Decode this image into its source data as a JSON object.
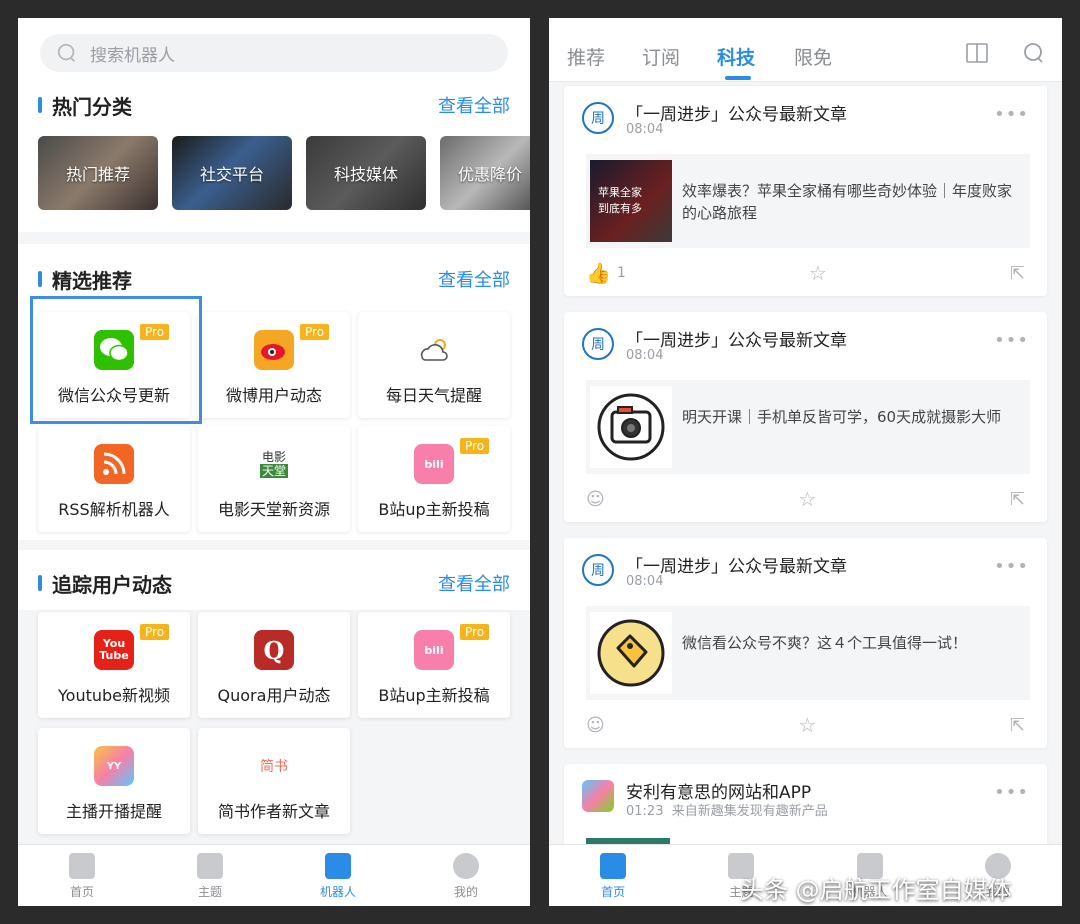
{
  "left": {
    "search": {
      "placeholder": "搜索机器人"
    },
    "hot": {
      "title": "热门分类",
      "see_all": "查看全部",
      "categories": [
        "热门推荐",
        "社交平台",
        "科技媒体",
        "优惠降价"
      ]
    },
    "featured": {
      "title": "精选推荐",
      "see_all": "查看全部",
      "bots": [
        {
          "name": "微信公众号更新",
          "pro": "Pro",
          "icon": "wechat-icon",
          "color": "#2dc100"
        },
        {
          "name": "微博用户动态",
          "pro": "Pro",
          "icon": "weibo-icon",
          "color": "#f5a623"
        },
        {
          "name": "每日天气提醒",
          "pro": "",
          "icon": "weather-icon",
          "color": "#ffffff"
        },
        {
          "name": "RSS解析机器人",
          "pro": "",
          "icon": "rss-icon",
          "color": "#f26522"
        },
        {
          "name": "电影天堂新资源",
          "pro": "",
          "icon": "movie-icon",
          "color": "#ffffff"
        },
        {
          "name": "B站up主新投稿",
          "pro": "Pro",
          "icon": "bilibili-icon",
          "color": "#f77fa9"
        }
      ]
    },
    "track": {
      "title": "追踪用户动态",
      "see_all": "查看全部",
      "bots": [
        {
          "name": "Youtube新视频",
          "pro": "Pro",
          "icon": "youtube-icon",
          "color": "#e62117"
        },
        {
          "name": "Quora用户动态",
          "pro": "",
          "icon": "quora-icon",
          "color": "#b92b27"
        },
        {
          "name": "B站up主新投稿",
          "pro": "Pro",
          "icon": "bilibili-icon",
          "color": "#f77fa9"
        },
        {
          "name": "主播开播提醒",
          "pro": "",
          "icon": "live-icon",
          "color": "#f5c342"
        },
        {
          "name": "简书作者新文章",
          "pro": "",
          "icon": "jianshu-icon",
          "color": "#ffffff"
        }
      ]
    },
    "tabbar": [
      {
        "label": "首页",
        "icon": "home-icon"
      },
      {
        "label": "主题",
        "icon": "grid-icon"
      },
      {
        "label": "机器人",
        "icon": "robot-icon"
      },
      {
        "label": "我的",
        "icon": "user-icon"
      }
    ]
  },
  "right": {
    "tabs": [
      "推荐",
      "订阅",
      "科技",
      "限免"
    ],
    "active_tab": "科技",
    "cards": [
      {
        "avatar": "周",
        "title": "「一周进步」公众号最新文章",
        "time": "08:04",
        "body": "效率爆表？苹果全家桶有哪些奇妙体验｜年度败家的心路旅程",
        "likes": "1"
      },
      {
        "avatar": "周",
        "title": "「一周进步」公众号最新文章",
        "time": "08:04",
        "body": "明天开课｜手机单反皆可学，60天成就摄影大师",
        "likes": ""
      },
      {
        "avatar": "周",
        "title": "「一周进步」公众号最新文章",
        "time": "08:04",
        "body": "微信看公众号不爽？这４个工具值得一试！",
        "likes": ""
      },
      {
        "avatar": "",
        "title": "安利有意思的网站和APP",
        "time": "01:23",
        "subtitle": "来自新趣集发现有趣新产品"
      }
    ],
    "thumb1_text": "苹果全家\n到底有多",
    "tabbar": [
      {
        "label": "首页",
        "icon": "home-icon"
      },
      {
        "label": "主题",
        "icon": "grid-icon"
      },
      {
        "label": "机器人",
        "icon": "robot-icon"
      },
      {
        "label": "我的",
        "icon": "user-icon"
      }
    ]
  },
  "watermark": "头条 @启航工作室自媒体",
  "colors": {
    "accent": "#2b8ce8",
    "pro_badge": "#f6b41a"
  }
}
